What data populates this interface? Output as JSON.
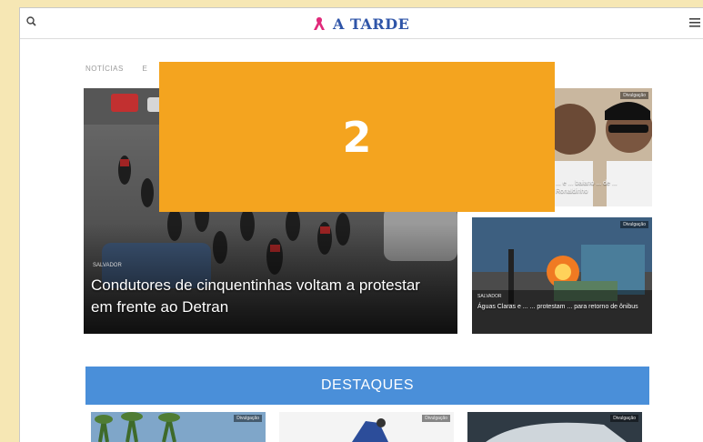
{
  "header": {
    "logo_text": "A TARDE",
    "search_icon": "search-icon",
    "menu_icon": "hamburger-menu-icon"
  },
  "nav": {
    "items": [
      "NOTÍCIAS",
      "E"
    ]
  },
  "overlay": {
    "number": "2",
    "color": "#f4a41f"
  },
  "hero": {
    "tag": "SALVADOR",
    "title": "Condutores de cinquentinhas voltam a protestar em frente ao Detran"
  },
  "side_story_1": {
    "badge": "Divulgação",
    "title": "... e ... baiano ... de ... Ronaldinho"
  },
  "side_story_2": {
    "badge": "Divulgação",
    "tag": "SALVADOR",
    "title": "Águas Claras e ... ... protestam ... para retorno de ônibus"
  },
  "destaques": {
    "label": "DESTAQUES",
    "color": "#4a8fd9"
  },
  "thumbs": [
    {
      "badge": "Divulgação"
    },
    {
      "badge": "Divulgação"
    },
    {
      "badge": "Divulgação"
    }
  ]
}
